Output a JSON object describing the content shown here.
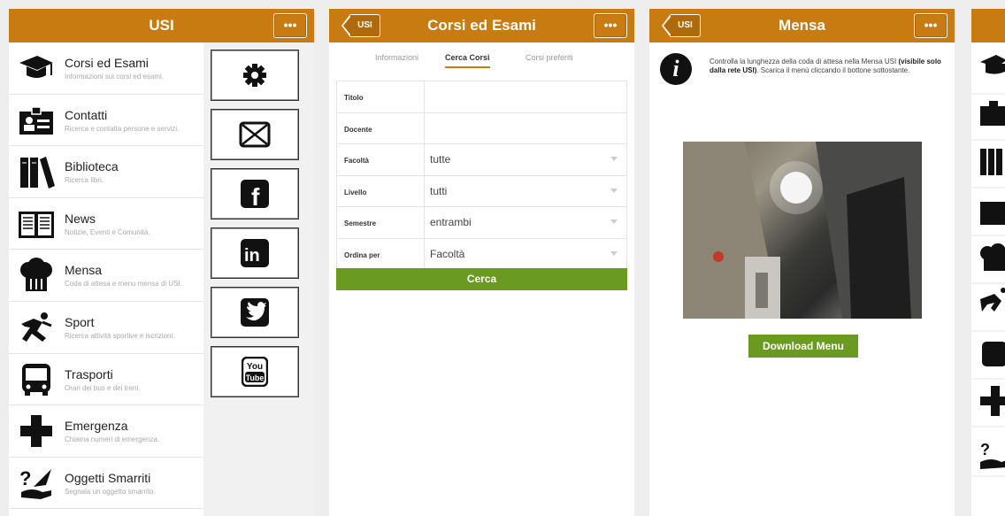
{
  "colors": {
    "header": "#c87b10",
    "accent_green": "#6a9a1f"
  },
  "panel1": {
    "title": "USI",
    "more": "•••",
    "menu": [
      {
        "label": "Corsi ed Esami",
        "sub": "Informazioni sui corsi ed esami.",
        "icon": "graduation-cap-icon"
      },
      {
        "label": "Contatti",
        "sub": "Ricerca e contatta persone e servizi.",
        "icon": "contact-card-icon"
      },
      {
        "label": "Biblioteca",
        "sub": "Ricerca libri.",
        "icon": "books-icon"
      },
      {
        "label": "News",
        "sub": "Notizie, Eventi e Comunità.",
        "icon": "newspaper-icon"
      },
      {
        "label": "Mensa",
        "sub": "Coda di attesa e menu mensa di USI.",
        "icon": "chef-hat-icon"
      },
      {
        "label": "Sport",
        "sub": "Ricerca attività sportive e iscrizioni.",
        "icon": "runner-icon"
      },
      {
        "label": "Trasporti",
        "sub": "Orari dei bus e dei treni.",
        "icon": "bus-icon"
      },
      {
        "label": "Emergenza",
        "sub": "Chiama numeri di emergenza.",
        "icon": "cross-icon"
      },
      {
        "label": "Oggetti Smarriti",
        "sub": "Segnala un oggetto smarrito.",
        "icon": "lost-found-icon"
      }
    ],
    "side_buttons": [
      "gear-icon",
      "mail-icon",
      "facebook-icon",
      "linkedin-icon",
      "twitter-icon",
      "youtube-icon"
    ],
    "side_text": {
      "facebook": "f",
      "linkedin": "in",
      "youtube_top": "You",
      "youtube_bottom": "Tube"
    }
  },
  "panel2": {
    "back": "USI",
    "title": "Corsi ed Esami",
    "more": "•••",
    "tabs": [
      "Informazioni",
      "Cerca Corsi",
      "Corsi preferiti"
    ],
    "fields": [
      {
        "label": "Titolo",
        "value": ""
      },
      {
        "label": "Docente",
        "value": ""
      },
      {
        "label": "Facoltà",
        "value": "tutte"
      },
      {
        "label": "Livello",
        "value": "tutti"
      },
      {
        "label": "Semestre",
        "value": "entrambi"
      },
      {
        "label": "Ordina per",
        "value": "Facoltà"
      }
    ],
    "search_button": "Cerca"
  },
  "panel3": {
    "back": "USI",
    "title": "Mensa",
    "more": "•••",
    "info_glyph": "i",
    "info_text_1": "Controlla la lunghezza della coda di attesa nella Mensa USI ",
    "info_text_bold": "(visibile solo dalla rete USI)",
    "info_text_2": ". Scarica il menù cliccando il bottone sottostante.",
    "download_button": "Download Menu"
  }
}
